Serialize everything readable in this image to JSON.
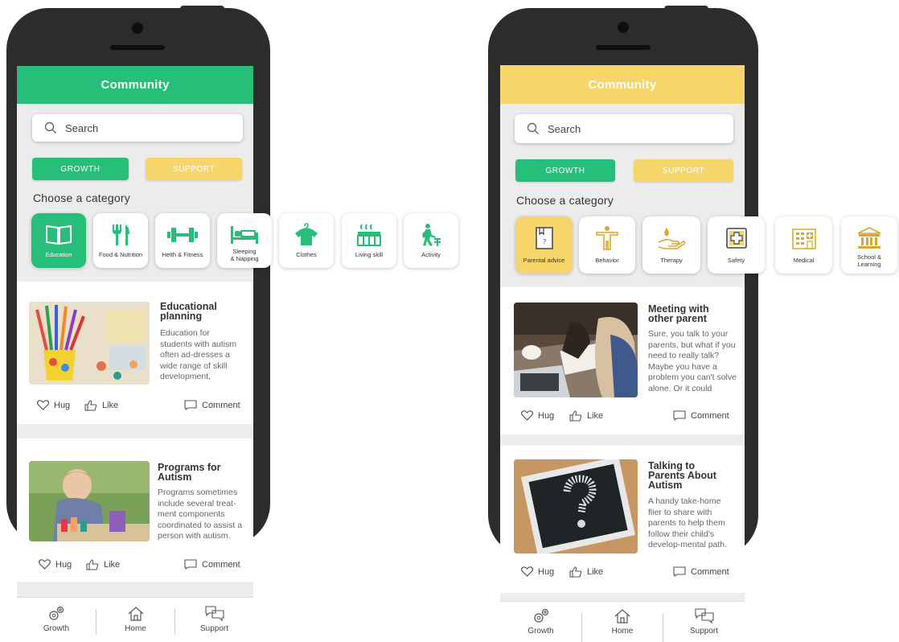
{
  "screens": [
    {
      "header": {
        "title": "Community",
        "color": "#27be7a"
      },
      "search": {
        "placeholder": "Search"
      },
      "tabs": {
        "growth": "GROWTH",
        "support": "SUPPORT"
      },
      "category_heading": "Choose a category",
      "categories": [
        {
          "label": "Education",
          "icon": "book-icon",
          "active": true
        },
        {
          "label": "Food & Nutrition",
          "icon": "fork-knife-icon"
        },
        {
          "label": "Helth & Fitness",
          "icon": "dumbbell-icon"
        },
        {
          "label": "Sleeping & Napping",
          "label_lines": [
            "Sleeping",
            "& Napping"
          ],
          "icon": "bed-icon"
        },
        {
          "label": "Clothes",
          "icon": "shirt-hanger-icon"
        },
        {
          "label": "Living skill",
          "icon": "stove-icon"
        },
        {
          "label": "Activity",
          "icon": "walker-icon"
        }
      ],
      "posts": [
        {
          "title_lines": [
            "Educational",
            "planning"
          ],
          "body": "Education for students with autism often ad-dresses a wide range of skill development, including academics,",
          "image": "pencils-photo"
        },
        {
          "title_lines": [
            "Programs for",
            "Autism"
          ],
          "body": "Programs sometimes include several treat-ment components coordinated to assist a person with autism.",
          "image": "child-painting-photo"
        }
      ],
      "actions": {
        "hug": "Hug",
        "like": "Like",
        "comment": "Comment"
      },
      "nav": [
        {
          "label": "Growth",
          "icon": "gears-icon"
        },
        {
          "label": "Home",
          "icon": "home-icon"
        },
        {
          "label": "Support",
          "icon": "chat-bubbles-icon"
        }
      ]
    },
    {
      "header": {
        "title": "Community",
        "color": "#f6d56b"
      },
      "search": {
        "placeholder": "Search"
      },
      "tabs": {
        "growth": "GROWTH",
        "support": "SUPPORT"
      },
      "category_heading": "Choose a category",
      "categories": [
        {
          "label": "Parental advice",
          "icon": "document-icon",
          "active": true
        },
        {
          "label": "Behavior",
          "icon": "person-icon"
        },
        {
          "label": "Therapy",
          "icon": "hand-drop-icon"
        },
        {
          "label": "Safety",
          "icon": "first-aid-icon"
        },
        {
          "label": "Medical",
          "icon": "hospital-icon"
        },
        {
          "label": "School & Learning",
          "label_lines": [
            "School &",
            "Learning"
          ],
          "icon": "school-icon"
        }
      ],
      "posts": [
        {
          "title_lines": [
            "Meeting with",
            "other parent"
          ],
          "body": "Sure, you talk to your parents, but what if you need to really talk? Maybe you have a problem you can't solve alone. Or it could",
          "image": "laptop-desk-photo"
        },
        {
          "title_lines": [
            "Talking to",
            "Parents About",
            "Autism"
          ],
          "body": "A handy take-home flier to share with parents to help them follow their child's develop-mental path. The flier",
          "image": "question-mark-chalkboard-photo"
        }
      ],
      "actions": {
        "hug": "Hug",
        "like": "Like",
        "comment": "Comment"
      },
      "nav": [
        {
          "label": "Growth",
          "icon": "gears-icon"
        },
        {
          "label": "Home",
          "icon": "home-icon"
        },
        {
          "label": "Support",
          "icon": "chat-bubbles-icon"
        }
      ]
    }
  ]
}
